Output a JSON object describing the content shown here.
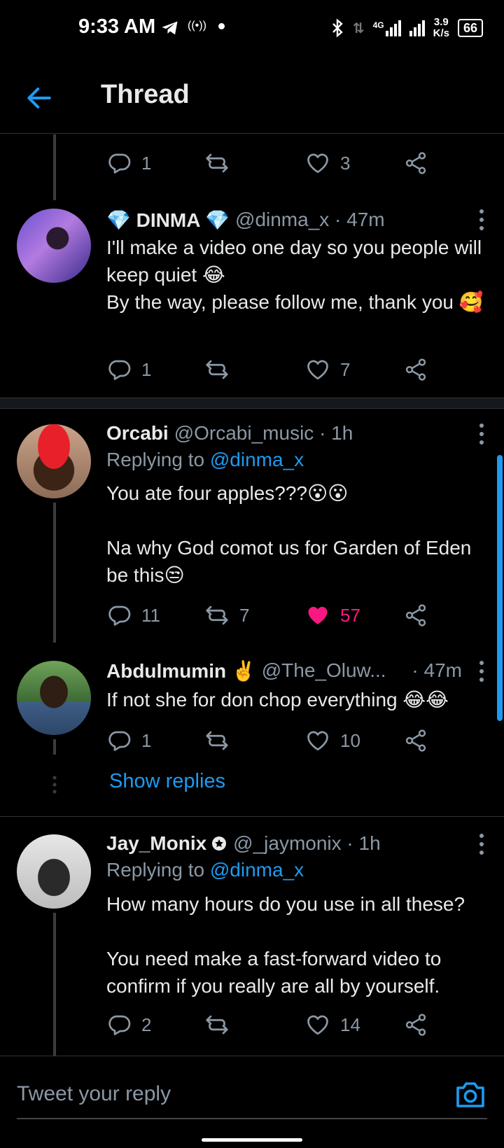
{
  "status_bar": {
    "time": "9:33 AM",
    "network": "4G",
    "speed": "3.9",
    "speed_unit": "K/s",
    "battery": "66"
  },
  "header": {
    "title": "Thread"
  },
  "partial_tweet": {
    "replies": "1",
    "retweets": "",
    "likes": "3"
  },
  "tweets": [
    {
      "name": "💎 DINMA 💎",
      "handle": "@dinma_x · 47m",
      "text": "I'll make a video one day so you people will keep quiet 😂\nBy the way, please follow me, thank you 🥰",
      "replies": "1",
      "retweets": "",
      "likes": "7",
      "liked": false
    },
    {
      "name": "Orcabi",
      "handle": "@Orcabi_music · 1h",
      "replying_prefix": "Replying to ",
      "replying_to": "@dinma_x",
      "text": "You ate four apples???😮😮\n\nNa why God comot us for Garden of Eden be this😒",
      "replies": "11",
      "retweets": "7",
      "likes": "57",
      "liked": true
    },
    {
      "name": "Abdulmumin ✌️",
      "handle": "@The_Oluw...",
      "time": "· 47m",
      "text": "If not she for don chop everything 😂😂",
      "replies": "1",
      "retweets": "",
      "likes": "10",
      "liked": false
    },
    {
      "name": "Jay_Monix",
      "handle": "@_jaymonix · 1h",
      "replying_prefix": "Replying to ",
      "replying_to": "@dinma_x",
      "text": "How many hours do you use in all these?\n\nYou need make a fast-forward video to confirm if you really are all by yourself.",
      "replies": "2",
      "retweets": "",
      "likes": "14",
      "liked": false
    }
  ],
  "show_replies_label": "Show replies",
  "composer": {
    "placeholder": "Tweet your reply"
  },
  "colors": {
    "accent": "#1d9bf0",
    "like": "#f91880",
    "muted": "#8b98a5",
    "bg": "#000000"
  }
}
